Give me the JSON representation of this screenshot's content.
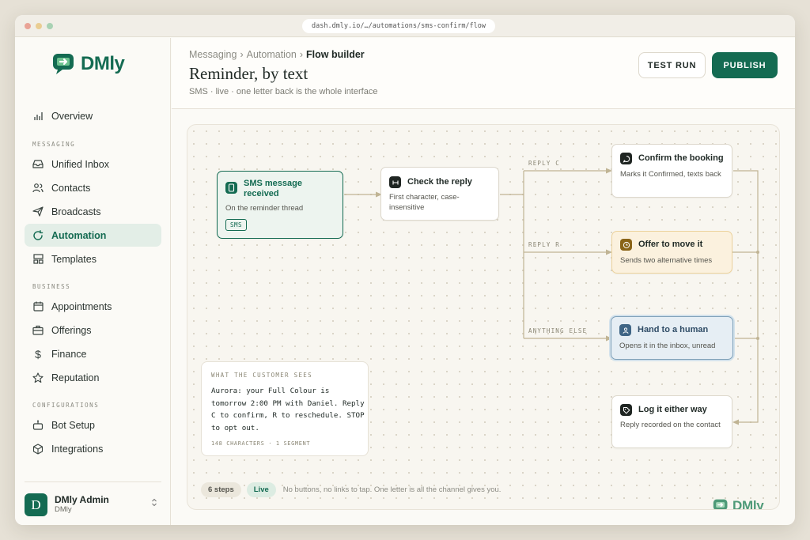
{
  "browser": {
    "url": "dash.dmly.io/…/automations/sms-confirm/flow"
  },
  "brand": {
    "name": "DMly",
    "color": "#146b52"
  },
  "sidebar": {
    "overview": "Overview",
    "sections": {
      "messaging": "MESSAGING",
      "business": "BUSINESS",
      "configurations": "CONFIGURATIONS"
    },
    "items": [
      {
        "label": "Unified Inbox",
        "icon": "inbox-icon"
      },
      {
        "label": "Contacts",
        "icon": "contacts-icon"
      },
      {
        "label": "Broadcasts",
        "icon": "send-icon"
      },
      {
        "label": "Automation",
        "icon": "refresh-icon",
        "active": true
      },
      {
        "label": "Templates",
        "icon": "template-icon"
      },
      {
        "label": "Appointments",
        "icon": "calendar-icon"
      },
      {
        "label": "Offerings",
        "icon": "briefcase-icon"
      },
      {
        "label": "Finance",
        "icon": "dollar-icon"
      },
      {
        "label": "Reputation",
        "icon": "star-icon"
      },
      {
        "label": "Bot Setup",
        "icon": "bot-icon"
      },
      {
        "label": "Integrations",
        "icon": "cube-icon"
      }
    ],
    "user": {
      "initial": "D",
      "name": "DMly Admin",
      "org": "DMly"
    }
  },
  "header": {
    "breadcrumb": [
      "Messaging",
      "Automation",
      "Flow builder"
    ],
    "separator": "›",
    "title": "Reminder, by text",
    "subtitle": "SMS · live · one letter back is the whole interface",
    "test_label": "TEST RUN",
    "publish_label": "PUBLISH"
  },
  "flow": {
    "trigger": {
      "title": "SMS message received",
      "desc": "On the reminder thread",
      "tag": "SMS"
    },
    "check": {
      "title": "Check the reply",
      "desc": "First character, case-insensitive"
    },
    "edge_labels": {
      "c": "REPLY C",
      "r": "REPLY R",
      "else": "ANYTHING ELSE"
    },
    "confirm": {
      "title": "Confirm the booking",
      "desc": "Marks it Confirmed, texts back"
    },
    "offer": {
      "title": "Offer to move it",
      "desc": "Sends two alternative times"
    },
    "human": {
      "title": "Hand to a human",
      "desc": "Opens it in the inbox, unread"
    },
    "log": {
      "title": "Log it either way",
      "desc": "Reply recorded on the contact"
    },
    "colors": {
      "trigger": "#146b52",
      "offer_bg": "#fbf1de",
      "human_bg": "#e6eef4",
      "connector": "#c0b494"
    }
  },
  "preview": {
    "heading": "WHAT THE CUSTOMER SEES",
    "message": "Aurora: your Full Colour is tomorrow 2:00 PM with Daniel. Reply C to confirm, R to reschedule. STOP to opt out.",
    "meta": "148 CHARACTERS · 1 SEGMENT"
  },
  "footer": {
    "steps": "6 steps",
    "status": "Live",
    "note": "No buttons, no links to tap. One letter is all the channel gives you."
  }
}
